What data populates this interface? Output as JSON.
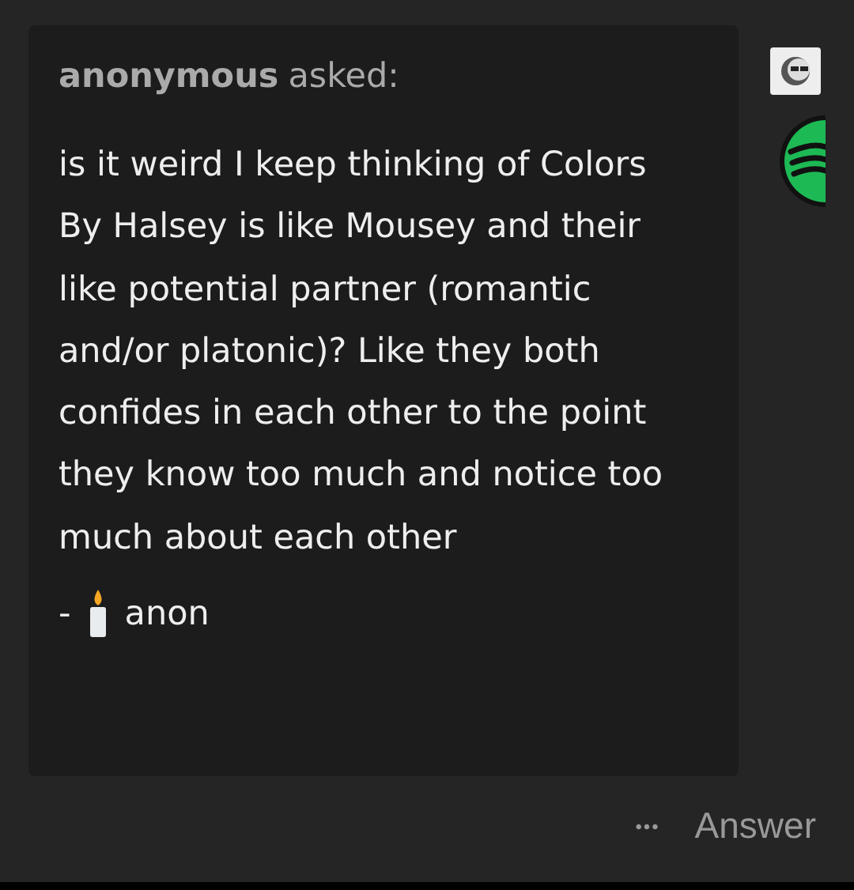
{
  "ask": {
    "asker": "anonymous",
    "verb": "asked:",
    "question": "is it weird I keep thinking of Colors By Halsey is like Mousey and their like potential partner (romantic and/or platonic)? Like they both confides in each other to the point they know too much and notice too much about each other",
    "signature_prefix": "-",
    "signature": "anon"
  },
  "actions": {
    "more": "•••",
    "answer": "Answer"
  }
}
